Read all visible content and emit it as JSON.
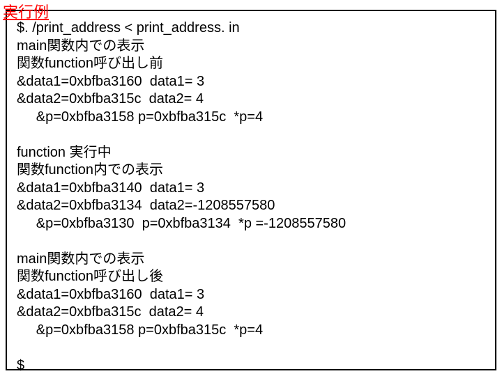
{
  "title": "実行例",
  "block1": {
    "l1": "$. /print_address < print_address. in",
    "l2": "main関数内での表示",
    "l3": "関数function呼び出し前",
    "l4": "&data1=0xbfba3160  data1= 3",
    "l5": "&data2=0xbfba315c  data2= 4",
    "l6": "     &p=0xbfba3158 p=0xbfba315c  *p=4"
  },
  "block2": {
    "l1": "function 実行中",
    "l2": "関数function内での表示",
    "l3": "&data1=0xbfba3140  data1= 3",
    "l4": "&data2=0xbfba3134  data2=-1208557580",
    "l5": "     &p=0xbfba3130  p=0xbfba3134  *p =-1208557580"
  },
  "block3": {
    "l1": "main関数内での表示",
    "l2": "関数function呼び出し後",
    "l3": "&data1=0xbfba3160  data1= 3",
    "l4": "&data2=0xbfba315c  data2= 4",
    "l5": "     &p=0xbfba3158 p=0xbfba315c  *p=4"
  },
  "prompt": "$"
}
